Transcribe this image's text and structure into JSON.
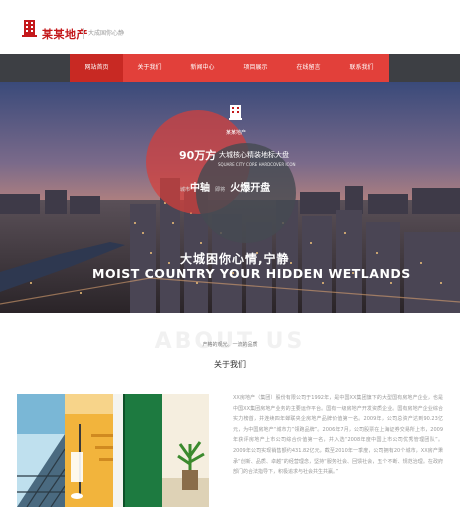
{
  "header": {
    "brand": "某某地产",
    "slogan": "大成国你心静"
  },
  "nav": {
    "items": [
      {
        "label": "网站首页",
        "active": true
      },
      {
        "label": "关于我们"
      },
      {
        "label": "新闻中心"
      },
      {
        "label": "项目展示"
      },
      {
        "label": "在线留言"
      },
      {
        "label": "联系我们"
      }
    ]
  },
  "banner": {
    "brand": "某某地产",
    "headline_num": "90万方",
    "headline_text": "大城核心精装地标大盘",
    "headline_en": "SQUARE CITY CORE HARDCOVER ICON",
    "row_prefix": "城市",
    "row_main1": "中轴",
    "row_mid": "即将",
    "row_main2": "火爆开盘",
    "tagline_cn": "大城困你心情,宁静",
    "tagline_en": "MOIST COUNTRY YOUR HIDDEN WETLANDS"
  },
  "about": {
    "ghost": "ABOUT US",
    "subtitle": "产格的观光。一流的品质",
    "title": "关于我们",
    "body": "XX房地产（集团）股份有限公司于1992年，是中国XX集团旗下的大型国有房地产企业，也是中国XX集团房地产业务的主要运作平台。国有一级房地产开发资质企业。国有房地产企业综合实力榜首，并连续四年蝉联央企房地产品牌价值第一名。2009年，公司总资产达到90.23亿元，为中国房地产“城市力”领跑品牌”。2006年7月，公司股票在上海证券交易所上市，2009年获评房地产上市公司综合价值第一名，并入选“2008年度中国上市公司优秀管理团队”。2009年公司实现销售额约431.82亿元，截至2010年一季度，公司拥有20个城市，XX房产秉承“创新、品质、卓越”的经营理念，坚持“服务社会、回馈社会，五个不断、规范治理。在政府部门的合法指导下，积极追求与社会共生共赢。”"
  },
  "colors": {
    "brand_red": "#c4191b",
    "nav_red": "#e2403a",
    "nav_dark": "#3d3f44"
  }
}
